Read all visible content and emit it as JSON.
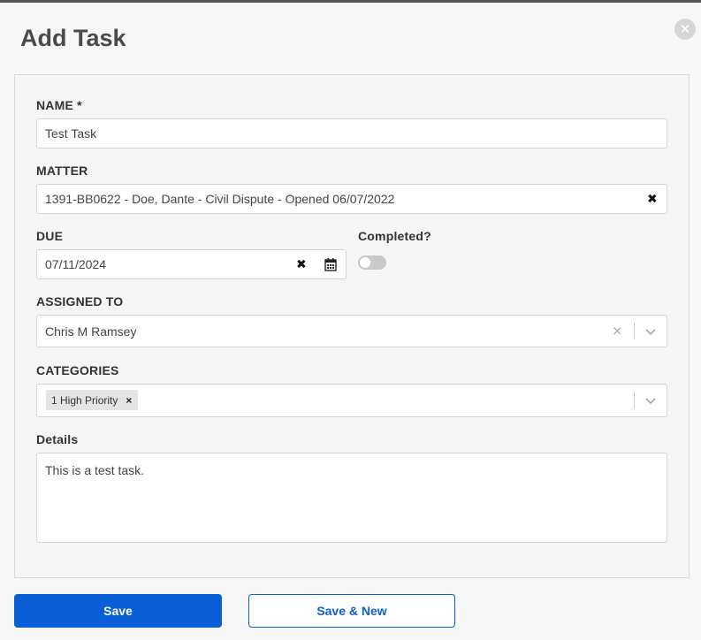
{
  "modal": {
    "title": "Add Task",
    "close_icon": "close-icon"
  },
  "form": {
    "name_label": "NAME *",
    "name_value": "Test Task",
    "matter_label": "MATTER",
    "matter_value": "1391-BB0622 - Doe, Dante - Civil Dispute - Opened 06/07/2022",
    "due_label": "DUE",
    "due_value": "07/11/2024",
    "completed_label": "Completed?",
    "completed_on": false,
    "assigned_label": "ASSIGNED TO",
    "assigned_value": "Chris M Ramsey",
    "categories_label": "CATEGORIES",
    "categories": [
      "1 High Priority"
    ],
    "details_label": "Details",
    "details_value": "This is a test task."
  },
  "actions": {
    "save_label": "Save",
    "save_new_label": "Save & New"
  },
  "colors": {
    "primary": "#0a5fd8",
    "toggle_off": "#c9c9c9"
  }
}
